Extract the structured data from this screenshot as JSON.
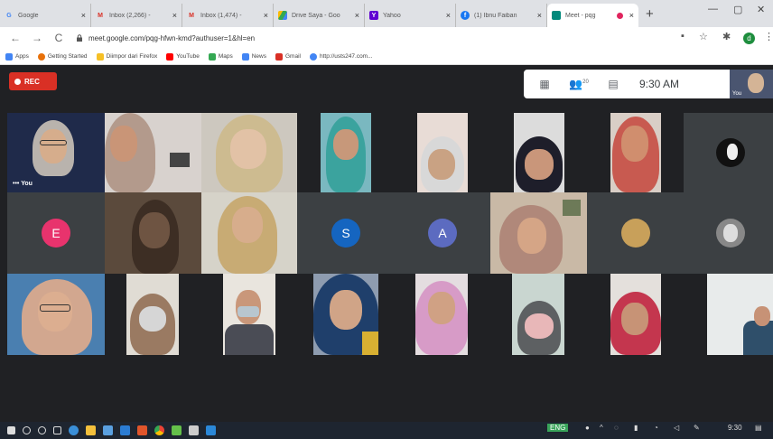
{
  "tabs": [
    {
      "label": "Google",
      "fav_color": "#dfe1e5",
      "fav_letter": "G",
      "fav_text": "#4285f4"
    },
    {
      "label": "Inbox (2,266) -",
      "fav_color": "#dfe1e5",
      "fav_letter": "M",
      "fav_text": "#d93025"
    },
    {
      "label": "Inbox (1,474) -",
      "fav_color": "#dfe1e5",
      "fav_letter": "M",
      "fav_text": "#d93025"
    },
    {
      "label": "Drive Saya - Goo",
      "fav_color": "#fbbc04",
      "fav_letter": "",
      "fav_text": "#fff"
    },
    {
      "label": "Yahoo",
      "fav_color": "#6001d2",
      "fav_letter": "Y",
      "fav_text": "#fff"
    },
    {
      "label": "(1) Ibnu Faiban",
      "fav_color": "#1877f2",
      "fav_letter": "f",
      "fav_text": "#fff"
    },
    {
      "label": "Meet - pqg",
      "fav_color": "#00897b",
      "fav_letter": "",
      "fav_text": "#fff"
    }
  ],
  "tab_close": "×",
  "new_tab": "+",
  "window": {
    "minimize": "—",
    "maximize": "▢",
    "close": "✕"
  },
  "url": "meet.google.com/pqg-hfwn-kmd?authuser=1&hl=en",
  "nav": {
    "back": "←",
    "forward": "→",
    "reload": "C"
  },
  "browser_icons": {
    "cast": "▪",
    "star": "☆",
    "extensions": "✱",
    "menu": "⋮"
  },
  "profile_letter": "d",
  "bookmarks": [
    {
      "label": "Apps",
      "color": "#4285f4"
    },
    {
      "label": "Getting Started",
      "color": "#e8710a"
    },
    {
      "label": "Diimpor dari Firefox",
      "color": "#f6c026"
    },
    {
      "label": "YouTube",
      "color": "#ff0000"
    },
    {
      "label": "Maps",
      "color": "#34a853"
    },
    {
      "label": "News",
      "color": "#4285f4"
    },
    {
      "label": "Gmail",
      "color": "#d93025"
    },
    {
      "label": "http://usts247.com...",
      "color": "#4285f4"
    }
  ],
  "meet": {
    "rec_label": "REC",
    "time": "9:30 AM",
    "self_thumb_label": "You",
    "you_label": "You",
    "self_more": "•••",
    "topbar_icons": [
      "grid-icon",
      "people-icon",
      "chat-icon"
    ],
    "topbar_glyphs": [
      "▦",
      "👥",
      "▤"
    ],
    "topbar_badge": "20",
    "avatars": [
      {
        "letter": "E",
        "color": "#e8336d"
      },
      {
        "letter": "S",
        "color": "#1565c0"
      },
      {
        "letter": "A",
        "color": "#5c6bc0"
      }
    ]
  },
  "taskbar": {
    "clock": "9:30",
    "lang": "ENG"
  }
}
